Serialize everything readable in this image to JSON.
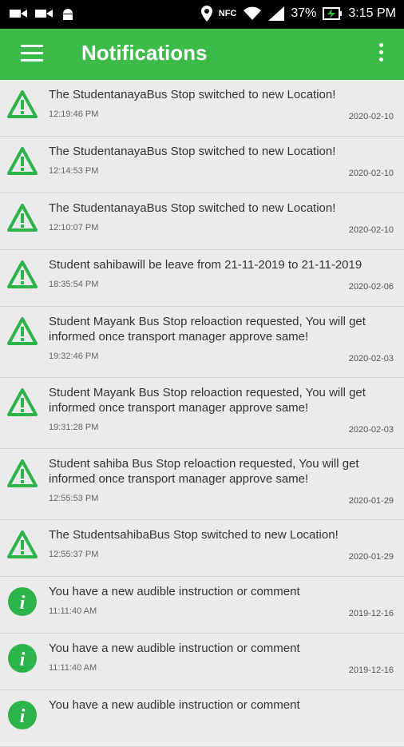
{
  "status": {
    "battery": "37%",
    "time": "3:15 PM",
    "nfc": "NFC"
  },
  "header": {
    "title": "Notifications"
  },
  "colors": {
    "brand": "#3dbb48",
    "background": "#ebebeb"
  },
  "notifications": [
    {
      "icon": "warning-icon",
      "message": "The StudentanayaBus Stop switched to new Location!",
      "time": "12:19:46 PM",
      "date": "2020-02-10"
    },
    {
      "icon": "warning-icon",
      "message": "The StudentanayaBus Stop switched to new Location!",
      "time": "12:14:53 PM",
      "date": "2020-02-10"
    },
    {
      "icon": "warning-icon",
      "message": "The StudentanayaBus Stop switched to new Location!",
      "time": "12:10:07 PM",
      "date": "2020-02-10"
    },
    {
      "icon": "warning-icon",
      "message": "Student sahibawill be leave from 21-11-2019 to 21-11-2019",
      "time": "18:35:54 PM",
      "date": "2020-02-06"
    },
    {
      "icon": "warning-icon",
      "message": "Student Mayank Bus Stop reloaction requested, You will get informed once transport manager approve same!",
      "time": "19:32:46 PM",
      "date": "2020-02-03"
    },
    {
      "icon": "warning-icon",
      "message": "Student Mayank Bus Stop reloaction requested, You will get informed once transport manager approve same!",
      "time": "19:31:28 PM",
      "date": "2020-02-03"
    },
    {
      "icon": "warning-icon",
      "message": "Student sahiba Bus Stop reloaction requested, You will get informed once transport manager approve same!",
      "time": "12:55:53 PM",
      "date": "2020-01-29"
    },
    {
      "icon": "warning-icon",
      "message": "The StudentsahibaBus Stop switched to new Location!",
      "time": "12:55:37 PM",
      "date": "2020-01-29"
    },
    {
      "icon": "info-icon",
      "message": "You have a new audible instruction or comment",
      "time": "11:11:40 AM",
      "date": "2019-12-16"
    },
    {
      "icon": "info-icon",
      "message": "You have a new audible instruction or comment",
      "time": "11:11:40 AM",
      "date": "2019-12-16"
    },
    {
      "icon": "info-icon",
      "message": "You have a new audible instruction or comment",
      "time": "",
      "date": ""
    }
  ]
}
